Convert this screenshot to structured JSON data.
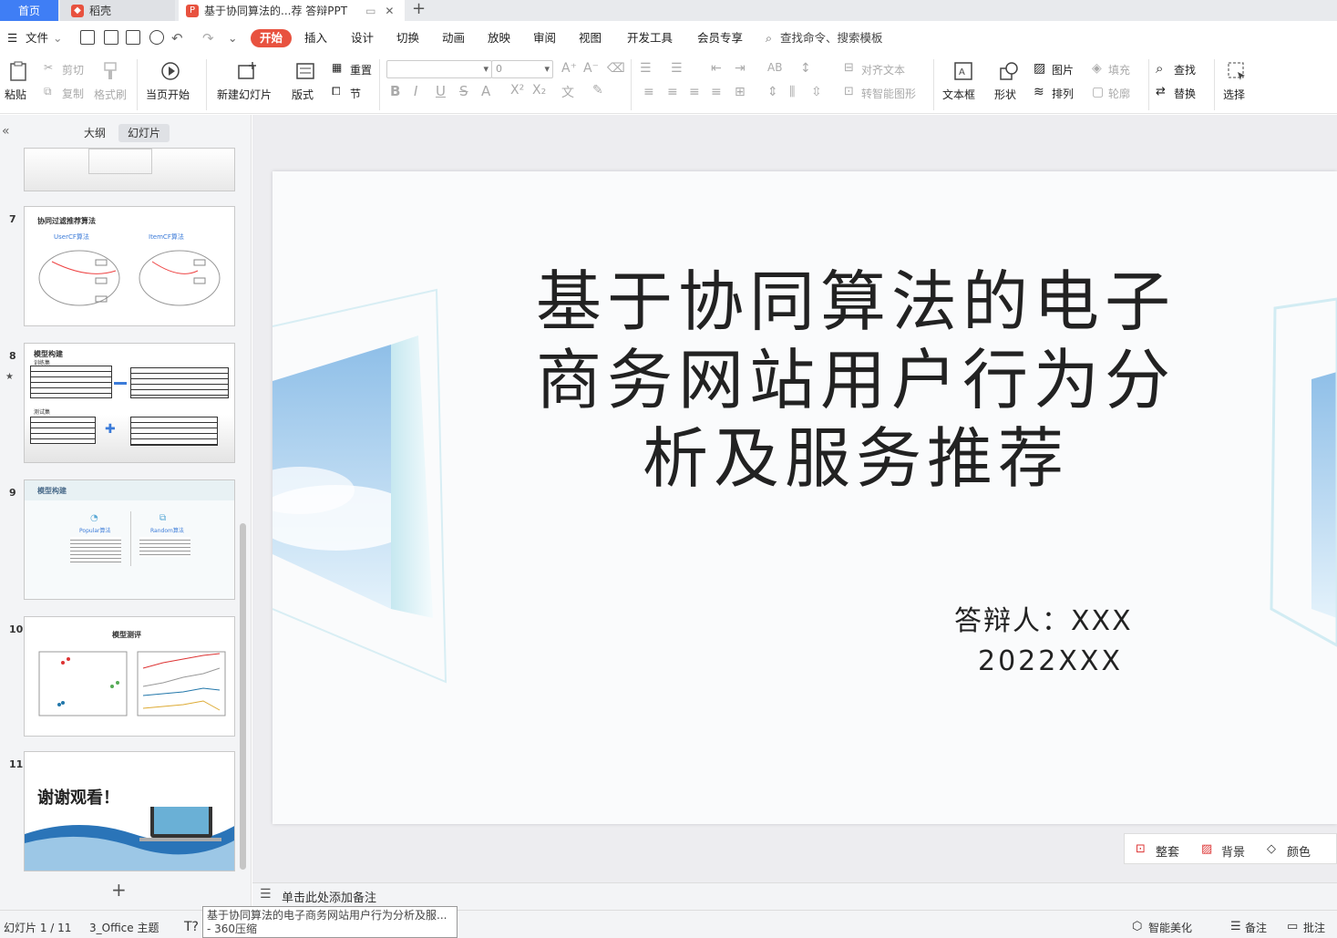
{
  "tabs": {
    "home": "首页",
    "daoke": "稻壳",
    "doc": "基于协同算法的...荐 答辩PPT",
    "new": "+"
  },
  "menu": {
    "file": "文件",
    "start": "开始",
    "insert": "插入",
    "design": "设计",
    "transition": "切换",
    "animation": "动画",
    "slideshow": "放映",
    "review": "审阅",
    "view": "视图",
    "developer": "开发工具",
    "vip": "会员专享",
    "search": "查找命令、搜索模板"
  },
  "ribbon": {
    "paste": "粘贴",
    "cut": "剪切",
    "copy": "复制",
    "format_painter": "格式刷",
    "from_current": "当页开始",
    "new_slide": "新建幻灯片",
    "layout": "版式",
    "reset": "重置",
    "section": "节",
    "font_size": "0",
    "align_text": "对齐文本",
    "smart_shape": "转智能图形",
    "textbox": "文本框",
    "shape": "形状",
    "picture": "图片",
    "arrange": "排列",
    "fill": "填充",
    "outline": "轮廓",
    "find": "查找",
    "replace": "替换",
    "select": "选择"
  },
  "panel": {
    "outline_tab": "大纲",
    "slides_tab": "幻灯片",
    "add": "+"
  },
  "thumbs": [
    {
      "num": "7",
      "title": "协同过滤推荐算法",
      "left": "UserCF算法",
      "right": "ItemCF算法"
    },
    {
      "num": "8",
      "title": "模型构建",
      "sub1": "训练集",
      "sub2": "测试集"
    },
    {
      "num": "9",
      "title": "模型构建",
      "left": "Popular算法",
      "right": "Random算法"
    },
    {
      "num": "10",
      "title": "模型测评"
    },
    {
      "num": "11",
      "title": "谢谢观看！"
    }
  ],
  "slide": {
    "title": "基于协同算法的电子商务网站用户行为分析及服务推荐",
    "presenter": "答辩人：XXX",
    "date": "2022XXX"
  },
  "design_tools": {
    "whole": "整套",
    "background": "背景",
    "color": "颜色"
  },
  "notes": {
    "placeholder": "单击此处添加备注"
  },
  "status": {
    "slide_count": "幻灯片 1 / 11",
    "theme": "3_Office 主题",
    "beautify": "智能美化",
    "notes": "备注",
    "comment": "批注",
    "tooltip": "基于协同算法的电子商务网站用户行为分析及服... - 360压缩"
  },
  "colors": {
    "accent": "#3f7ef5",
    "start": "#e8523f"
  }
}
